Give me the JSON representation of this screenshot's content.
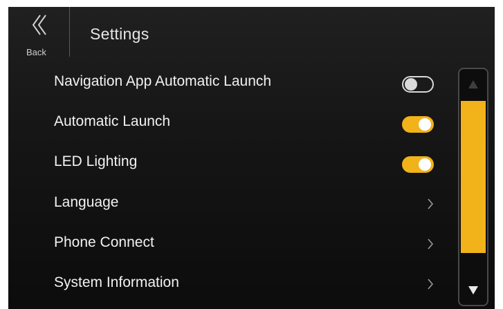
{
  "header": {
    "back_label": "Back",
    "title": "Settings"
  },
  "settings": [
    {
      "label": "Navigation App Automatic Launch",
      "control": "toggle",
      "state": "off"
    },
    {
      "label": "Automatic Launch",
      "control": "toggle",
      "state": "on"
    },
    {
      "label": "LED Lighting",
      "control": "toggle",
      "state": "on"
    },
    {
      "label": "Language",
      "control": "chevron-right-icon"
    },
    {
      "label": "Phone Connect",
      "control": "chevron-right-icon"
    },
    {
      "label": "System Information",
      "control": "chevron-right-icon"
    }
  ],
  "scrollbar": {
    "up_icon": "triangle-up-icon",
    "down_icon": "triangle-down-icon",
    "up_enabled": false,
    "down_enabled": true
  },
  "colors": {
    "accent": "#f2b21a",
    "background": "#141414",
    "text": "#f2f2f2"
  }
}
